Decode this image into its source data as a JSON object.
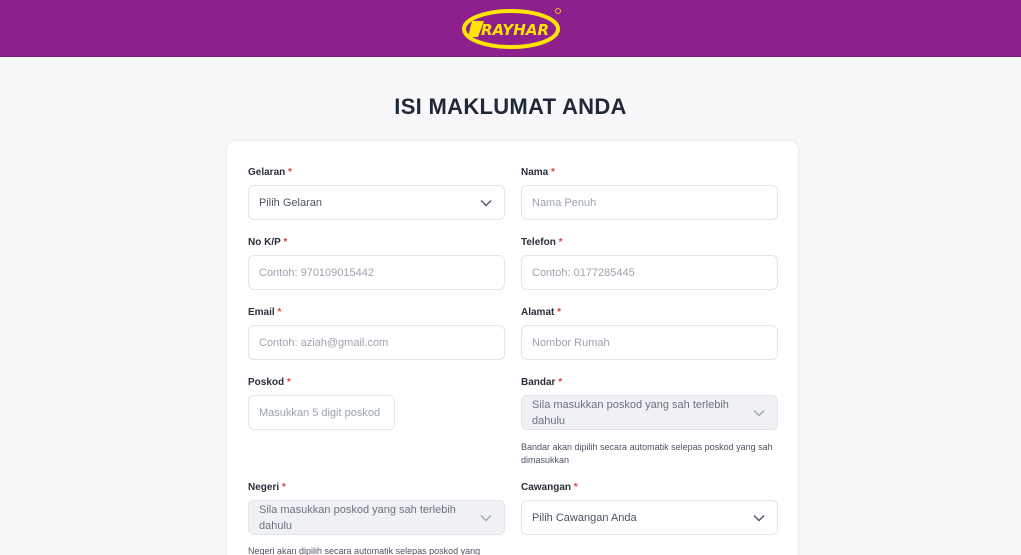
{
  "header": {
    "brand_color": "#8e208e",
    "logo_text": "RAYHAR",
    "logo_color": "#ffe500"
  },
  "page": {
    "title": "ISI MAKLUMAT ANDA"
  },
  "form": {
    "required_marker": "*",
    "gelaran": {
      "label": "Gelaran",
      "value": "Pilih Gelaran"
    },
    "nama": {
      "label": "Nama",
      "placeholder": "Nama Penuh"
    },
    "nokp": {
      "label": "No K/P",
      "placeholder": "Contoh: 970109015442"
    },
    "telefon": {
      "label": "Telefon",
      "placeholder": "Contoh: 0177285445"
    },
    "email": {
      "label": "Email",
      "placeholder": "Contoh: aziah@gmail.com"
    },
    "alamat": {
      "label": "Alamat",
      "placeholder": "Nombor Rumah"
    },
    "poskod": {
      "label": "Poskod",
      "placeholder": "Masukkan 5 digit poskod"
    },
    "bandar": {
      "label": "Bandar",
      "value": "Sila masukkan poskod yang sah terlebih dahulu",
      "hint": "Bandar akan dipilih secara automatik selepas poskod yang sah dimasukkan"
    },
    "negeri": {
      "label": "Negeri",
      "value": "Sila masukkan poskod yang sah terlebih dahulu",
      "hint": "Negeri akan dipilih secara automatik selepas poskod yang"
    },
    "cawangan": {
      "label": "Cawangan",
      "value": "Pilih Cawangan Anda"
    }
  }
}
